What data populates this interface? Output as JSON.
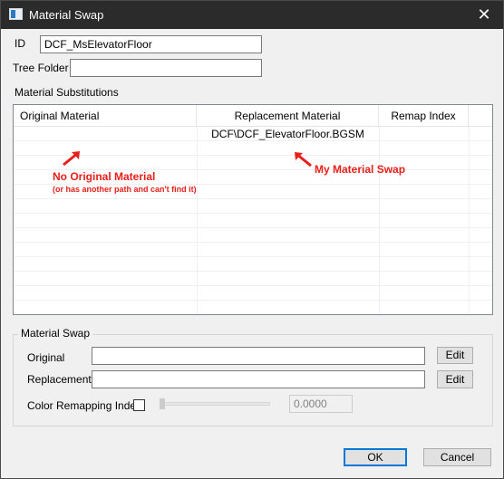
{
  "window": {
    "title": "Material Swap",
    "close_glyph": "✕",
    "icon": "app-window-icon"
  },
  "form": {
    "id_label": "ID",
    "id_value": "DCF_MsElevatorFloor",
    "tree_folder_label": "Tree Folder",
    "tree_folder_value": ""
  },
  "substitutions": {
    "group_label": "Material Substitutions",
    "columns": [
      "Original Material",
      "Replacement Material",
      "Remap Index"
    ],
    "rows": [
      {
        "original": "",
        "replacement": "DCF\\DCF_ElevatorFloor.BGSM",
        "remap": ""
      }
    ]
  },
  "annotations": {
    "left_title": "No Original Material",
    "left_subtitle": "(or has another path and can't find it)",
    "right_title": "My Material Swap",
    "color": "#e8201a"
  },
  "swap": {
    "group_label": "Material Swap",
    "original_label": "Original",
    "original_value": "",
    "replacement_label": "Replacement",
    "replacement_value": "",
    "edit_label": "Edit",
    "color_remap_label": "Color Remapping Index",
    "color_remap_checked": false,
    "color_remap_value": "0.0000"
  },
  "footer": {
    "ok_label": "OK",
    "cancel_label": "Cancel"
  },
  "colors": {
    "titlebar": "#2b2b2b",
    "accent": "#0078d7"
  }
}
